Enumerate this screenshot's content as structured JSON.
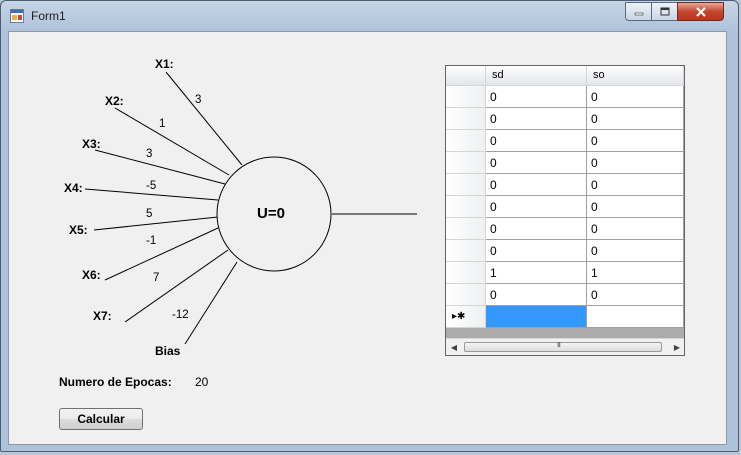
{
  "window": {
    "title": "Form1"
  },
  "diagram": {
    "inputs": [
      {
        "label": "X1:",
        "weight": "3"
      },
      {
        "label": "X2:",
        "weight": "1"
      },
      {
        "label": "X3:",
        "weight": "3"
      },
      {
        "label": "X4:",
        "weight": "-5"
      },
      {
        "label": "X5:",
        "weight": "5"
      },
      {
        "label": "X6:",
        "weight": "-1"
      },
      {
        "label": "X7:",
        "weight": "7"
      }
    ],
    "bias": {
      "label": "Bias",
      "weight": "-12"
    },
    "neuron_label": "U=0"
  },
  "epocas": {
    "label": "Numero de Epocas:",
    "value": "20"
  },
  "calc_button": "Calcular",
  "grid": {
    "columns": [
      "sd",
      "so"
    ],
    "rows": [
      [
        "0",
        "0"
      ],
      [
        "0",
        "0"
      ],
      [
        "0",
        "0"
      ],
      [
        "0",
        "0"
      ],
      [
        "0",
        "0"
      ],
      [
        "0",
        "0"
      ],
      [
        "0",
        "0"
      ],
      [
        "0",
        "0"
      ],
      [
        "1",
        "1"
      ],
      [
        "0",
        "0"
      ]
    ],
    "new_row_marker": "▸✱",
    "scroll_grip": "III"
  },
  "icons": {
    "app": "form-app-icon",
    "minimize": "minimize-icon",
    "maximize": "maximize-icon",
    "close": "close-icon"
  }
}
